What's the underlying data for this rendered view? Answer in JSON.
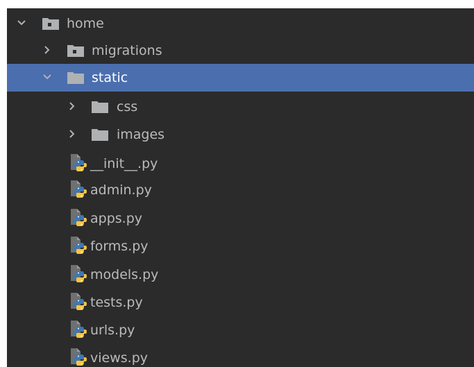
{
  "tree": {
    "items": [
      {
        "label": "home",
        "kind": "package",
        "expanded": true
      },
      {
        "label": "migrations",
        "kind": "package",
        "expanded": false
      },
      {
        "label": "static",
        "kind": "folder",
        "expanded": true,
        "selected": true
      },
      {
        "label": "css",
        "kind": "folder",
        "expanded": false
      },
      {
        "label": "images",
        "kind": "folder",
        "expanded": false
      },
      {
        "label": "__init__.py",
        "kind": "python-file"
      },
      {
        "label": "admin.py",
        "kind": "python-file"
      },
      {
        "label": "apps.py",
        "kind": "python-file"
      },
      {
        "label": "forms.py",
        "kind": "python-file"
      },
      {
        "label": "models.py",
        "kind": "python-file"
      },
      {
        "label": "tests.py",
        "kind": "python-file"
      },
      {
        "label": "urls.py",
        "kind": "python-file"
      },
      {
        "label": "views.py",
        "kind": "python-file"
      }
    ]
  },
  "colors": {
    "background": "#2b2b2b",
    "selection": "#4b6eaf",
    "text": "#bbbbbb",
    "folder": "#afb1b3",
    "python_blue": "#3c78b5",
    "python_yellow": "#f5c542"
  }
}
